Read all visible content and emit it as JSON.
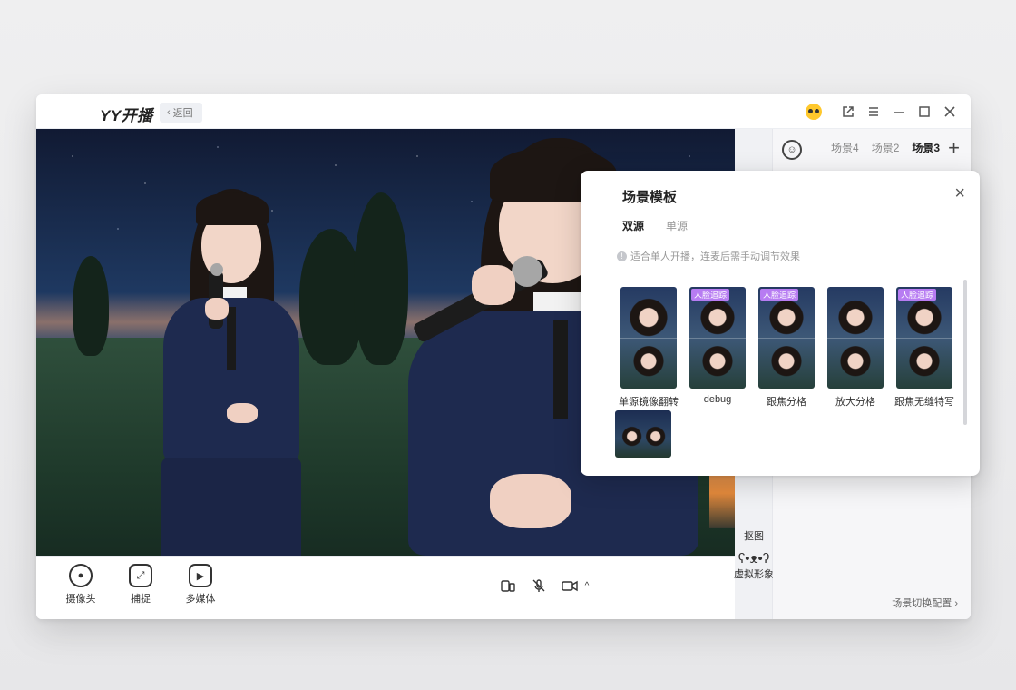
{
  "titlebar": {
    "app_title": "YY开播",
    "back_label": "返回"
  },
  "window_controls": {
    "mascot_icon": "mascot-icon",
    "share_icon": "external-link-icon",
    "menu_icon": "menu-icon",
    "minimize_icon": "minimize-icon",
    "maximize_icon": "maximize-icon",
    "close_icon": "close-icon"
  },
  "bottom_tools": [
    {
      "label": "摄像头",
      "icon": "camera-icon"
    },
    {
      "label": "捕捉",
      "icon": "capture-icon"
    },
    {
      "label": "多媒体",
      "icon": "play-icon"
    }
  ],
  "media_controls": {
    "devices_icon": "devices-icon",
    "mic_off_icon": "mic-off-icon",
    "video_icon": "video-icon",
    "expand_icon": "caret-up-icon"
  },
  "side_items": [
    {
      "label": "抠图",
      "icon": "cutout-icon"
    },
    {
      "label": "虚拟形象",
      "icon": "avatar-icon"
    }
  ],
  "scenes": {
    "tabs": [
      "场景4",
      "场景2",
      "场景3"
    ],
    "active_tab": "场景3",
    "add_label": "+",
    "config_label": "场景切换配置 ›"
  },
  "popup": {
    "title": "场景模板",
    "close_label": "×",
    "tabs": [
      "双源",
      "单源"
    ],
    "active_tab": "双源",
    "hint": "适合单人开播，连麦后需手动调节效果",
    "templates": [
      {
        "name": "单源镜像翻转",
        "badge": ""
      },
      {
        "name": "debug",
        "badge": "人脸追踪"
      },
      {
        "name": "跟焦分格",
        "badge": "人脸追踪"
      },
      {
        "name": "放大分格",
        "badge": ""
      },
      {
        "name": "跟焦无缝特写",
        "badge": "人脸追踪"
      },
      {
        "name": "",
        "badge": ""
      }
    ]
  },
  "colors": {
    "accent_badge": "#b77cf2",
    "brand_yellow": "#ffc82c"
  }
}
